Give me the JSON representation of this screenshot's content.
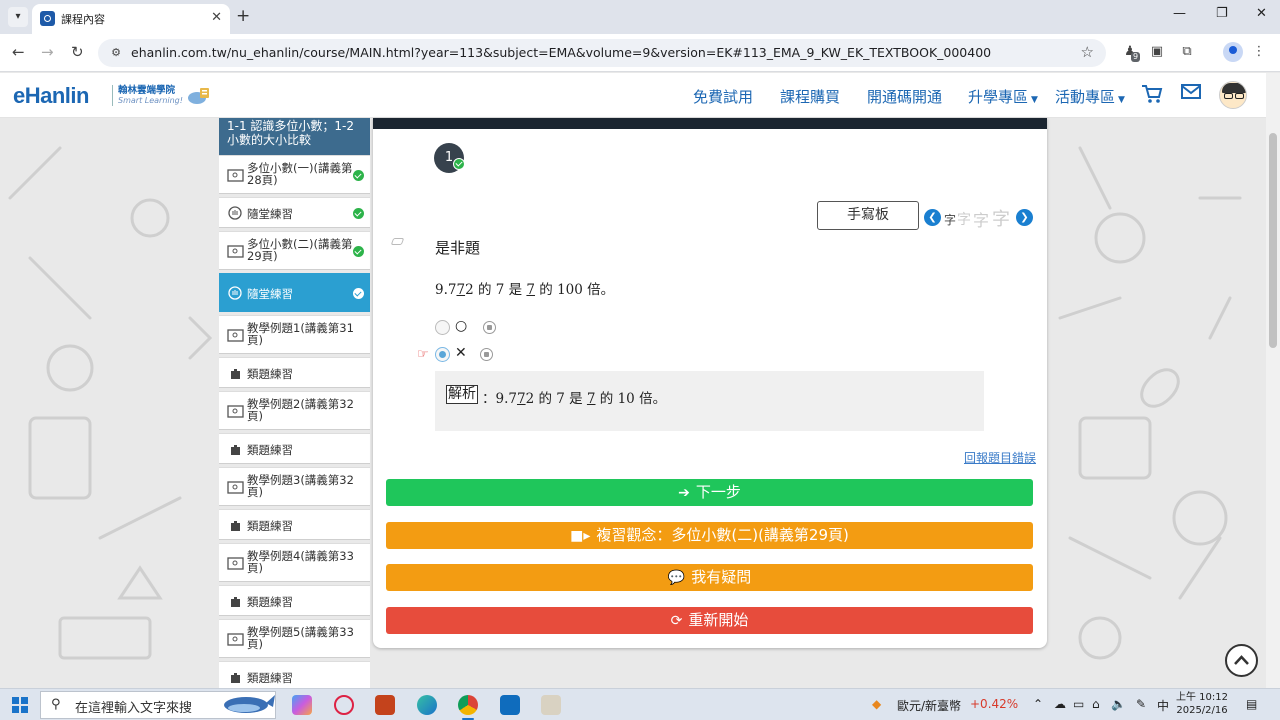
{
  "browser": {
    "tab_title": "課程內容",
    "url": "ehanlin.com.tw/nu_ehanlin/course/MAIN.html?year=113&subject=EMA&volume=9&version=EK#113_EMA_9_KW_EK_TEXTBOOK_000400",
    "extension_badge": "9"
  },
  "site": {
    "logo": "eHanlin",
    "logo_cn": "翰林雲端學院",
    "logo_en": "Smart Learning!",
    "nav": {
      "free_trial": "免費試用",
      "purchase": "課程購買",
      "activation": "開通碼開通",
      "upgrade": "升學專區",
      "events": "活動專區"
    }
  },
  "sidebar": {
    "header": "1-1 認識多位小數；1-2 小數的大小比較",
    "items": [
      {
        "label": "多位小數(一)(講義第28頁)",
        "type": "video",
        "done": true
      },
      {
        "label": "隨堂練習",
        "type": "practice",
        "done": true
      },
      {
        "label": "多位小數(二)(講義第29頁)",
        "type": "video",
        "done": true
      },
      {
        "label": "隨堂練習",
        "type": "practice",
        "done": true,
        "active": true
      },
      {
        "label": "教學例題1(講義第31頁)",
        "type": "video"
      },
      {
        "label": "類題練習",
        "type": "puzzle"
      },
      {
        "label": "教學例題2(講義第32頁)",
        "type": "video"
      },
      {
        "label": "類題練習",
        "type": "puzzle"
      },
      {
        "label": "教學例題3(講義第32頁)",
        "type": "video"
      },
      {
        "label": "類題練習",
        "type": "puzzle"
      },
      {
        "label": "教學例題4(講義第33頁)",
        "type": "video"
      },
      {
        "label": "類題練習",
        "type": "puzzle"
      },
      {
        "label": "教學例題5(講義第33頁)",
        "type": "video"
      },
      {
        "label": "類題練習",
        "type": "puzzle"
      }
    ]
  },
  "question": {
    "number": "1",
    "handwriting_label": "手寫板",
    "font_glyph": "字",
    "type": "是非題",
    "text_prefix": "9.7",
    "text_u1": "7",
    "text_mid": "2 的 7 是 ",
    "text_u2": "7",
    "text_suffix": " 的 100 倍。",
    "option_o": "○",
    "option_x": "✕",
    "explanation_tag": "解析",
    "exp_prefix": "：9.7",
    "exp_u1": "7",
    "exp_mid": "2 的 7 是 ",
    "exp_u2": "7",
    "exp_suffix": " 的 10 倍。",
    "report_link": "回報題目錯誤"
  },
  "buttons": {
    "next": "下一步",
    "review": "複習觀念：多位小數(二)(講義第29頁)",
    "question": "我有疑問",
    "restart": "重新開始"
  },
  "colors": {
    "next": "#1fc65b",
    "review": "#f39c12",
    "question": "#f39c12",
    "restart": "#e74c3c",
    "sidebar_active": "#2b9fd1",
    "brand": "#1c67b3"
  },
  "taskbar": {
    "search_placeholder": "在這裡輸入文字來搜",
    "currency": "歐元/新臺幣",
    "currency_change": "+0.42%",
    "ime": "中",
    "time": "上午 10:12",
    "date": "2025/2/16"
  }
}
